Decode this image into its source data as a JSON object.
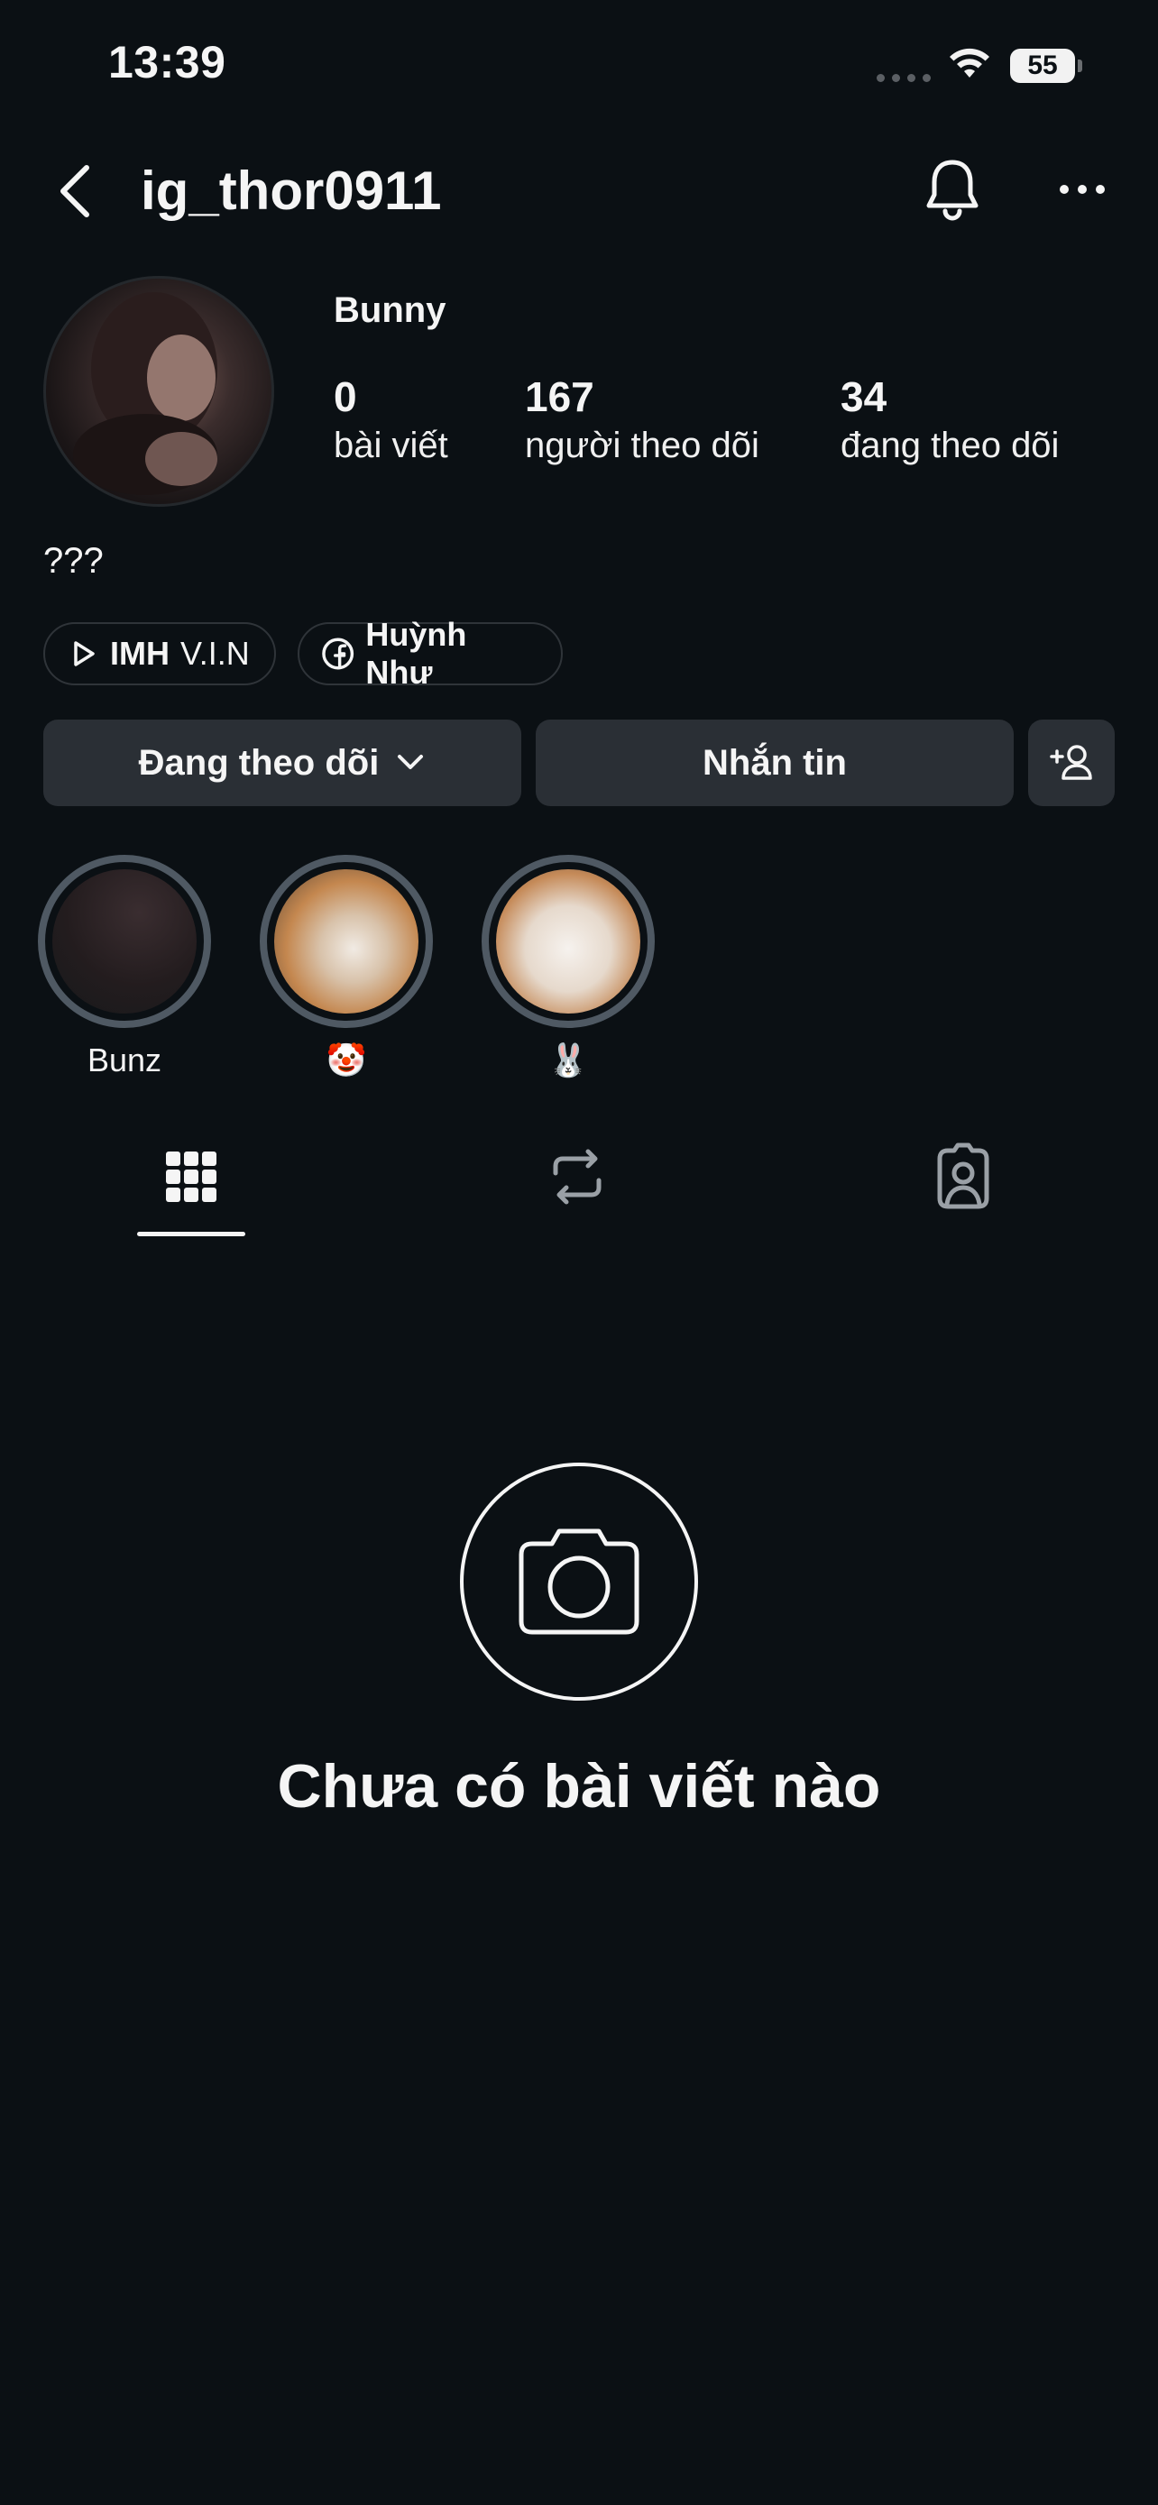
{
  "status_bar": {
    "time": "13:39",
    "battery": "55"
  },
  "header": {
    "username": "ig_thor0911"
  },
  "profile": {
    "display_name": "Bunny",
    "stats": [
      {
        "value": "0",
        "label": "bài viết"
      },
      {
        "value": "167",
        "label": "người theo dõi"
      },
      {
        "value": "34",
        "label": "đang theo dõi"
      }
    ],
    "bio": "???"
  },
  "links": [
    {
      "icon": "play-icon",
      "bold": "IMH",
      "text": "V.I.N"
    },
    {
      "icon": "facebook-icon",
      "bold": "Huỳnh Như",
      "text": ""
    }
  ],
  "actions": {
    "following_label": "Đang theo dõi",
    "message_label": "Nhắn tin"
  },
  "highlights": [
    {
      "label": "Bunz"
    },
    {
      "label": "🤡"
    },
    {
      "label": "🐰"
    }
  ],
  "tabs": [
    {
      "icon": "grid-icon",
      "active": true
    },
    {
      "icon": "reposts-icon",
      "active": false
    },
    {
      "icon": "tagged-icon",
      "active": false
    }
  ],
  "empty_state": {
    "title": "Chưa có bài viết nào"
  }
}
